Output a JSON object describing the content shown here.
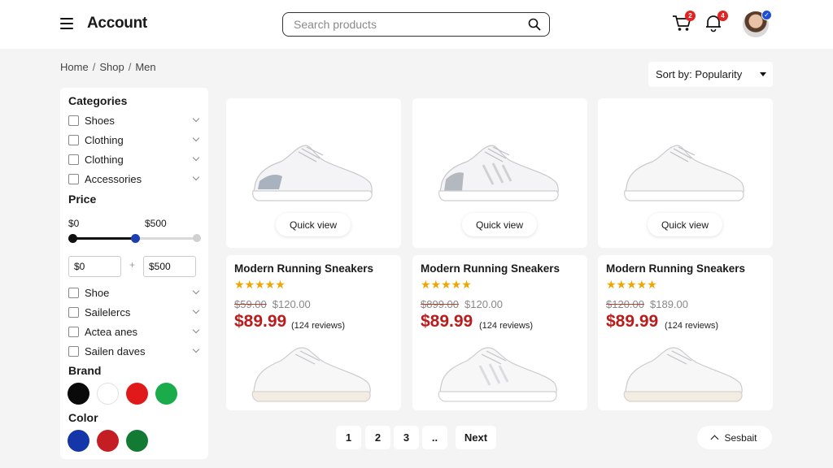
{
  "header": {
    "brand": "Account",
    "search_placeholder": "Search products",
    "cart_count": "2",
    "notification_count": "4"
  },
  "breadcrumb": [
    "Home",
    "Shop",
    "Men"
  ],
  "sort": {
    "label": "Sort by:",
    "value": "Popularity"
  },
  "sidebar": {
    "categories_title": "Categories",
    "categories": [
      "Shoes",
      "Clothing",
      "Clothing",
      "Accessories"
    ],
    "price_title": "Price",
    "price_min_label": "$0",
    "price_max_label": "$500",
    "price_range_fraction": 0.5,
    "price_min_input": "$0",
    "price_max_input": "$500",
    "price_separator": "+",
    "extra_filters": [
      "Shoe",
      "Sailelercs",
      "Actea anes",
      "Sailen daves"
    ],
    "brand_title": "Brand",
    "brand_colors": [
      "#0a0a0a",
      "#ffffff",
      "#e01a1a",
      "#1aab4b"
    ],
    "color_title": "Color",
    "color_swatches": [
      "#1536a8",
      "#c41e24",
      "#127a32"
    ]
  },
  "products": [
    {
      "name": "Modern Running Sneakers",
      "rating": 5,
      "stars": "★★★★★",
      "old_price_1": "$59.00",
      "old_price_2": "$120.00",
      "price": "$89.99",
      "reviews": "(124 reviews)",
      "quick_view": "Quick view"
    },
    {
      "name": "Modern Running Sneakers",
      "rating": 5,
      "stars": "★★★★★",
      "old_price_1": "$899.00",
      "old_price_2": "$120.00",
      "price": "$89.99",
      "reviews": "(124 reviews)",
      "quick_view": "Quick view"
    },
    {
      "name": "Modern Running Sneakers",
      "rating": 5,
      "stars": "★★★★★",
      "old_price_1": "$120.00",
      "old_price_2": "$189.00",
      "price": "$89.99",
      "reviews": "(124 reviews)",
      "quick_view": "Quick view"
    }
  ],
  "pagination": {
    "pages": [
      "1",
      "2",
      "3",
      ".."
    ],
    "next": "Next"
  },
  "scroll_top": {
    "label": "Sesbait"
  },
  "colors": {
    "price_red": "#b91c1c",
    "star_gold": "#f0a500",
    "badge_red": "#e02424",
    "verified_blue": "#1d4ed8"
  },
  "icons": [
    "menu-icon",
    "search-icon",
    "cart-icon",
    "bell-icon",
    "chevron-down-icon",
    "chevron-up-icon"
  ]
}
